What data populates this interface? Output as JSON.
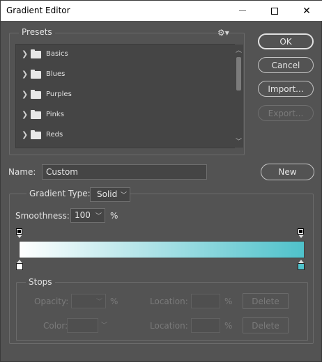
{
  "window": {
    "title": "Gradient Editor",
    "controls": {
      "minimize_icon": "minimize-icon",
      "maximize_icon": "maximize-icon",
      "close_glyph": "✕"
    }
  },
  "presets": {
    "label": "Presets",
    "menu_icon": "gear-icon",
    "items": [
      {
        "label": "Basics"
      },
      {
        "label": "Blues"
      },
      {
        "label": "Purples"
      },
      {
        "label": "Pinks"
      },
      {
        "label": "Reds"
      }
    ]
  },
  "buttons": {
    "ok": "OK",
    "cancel": "Cancel",
    "import": "Import...",
    "export": "Export...",
    "new": "New"
  },
  "name": {
    "label": "Name:",
    "value": "Custom"
  },
  "gradient": {
    "type_label": "Gradient Type:",
    "type_value": "Solid",
    "smoothness_label": "Smoothness:",
    "smoothness_value": "100",
    "smoothness_unit": "%",
    "start_color": "#ffffff",
    "end_color": "#4fc2cb"
  },
  "stops": {
    "label": "Stops",
    "opacity_label": "Opacity:",
    "opacity_unit": "%",
    "color_label": "Color:",
    "location_label_1": "Location:",
    "location_unit_1": "%",
    "location_label_2": "Location:",
    "location_unit_2": "%",
    "delete_1": "Delete",
    "delete_2": "Delete"
  }
}
